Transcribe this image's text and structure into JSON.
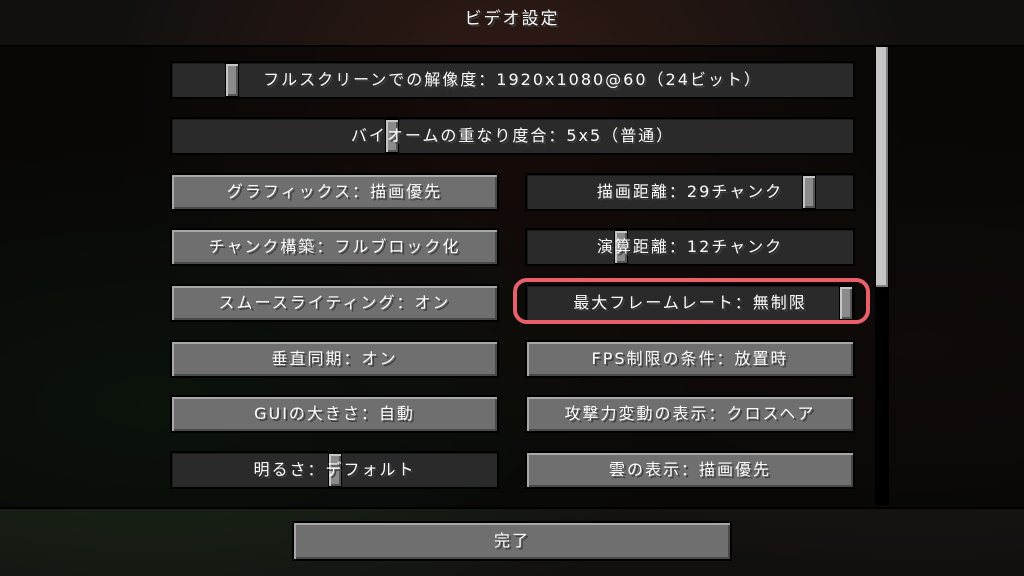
{
  "screen": {
    "title": "ビデオ設定"
  },
  "options": {
    "resolution": {
      "label": "フルスクリーンでの解像度：1920x1080@60（24ビット）",
      "level": 0.08
    },
    "biome_blend": {
      "label": "バイオームの重なり度合：5x5（普通）",
      "level": 0.32
    },
    "graphics": "グラフィックス：描画優先",
    "render_distance": {
      "label": "描画距離：29チャンク",
      "level": 0.88
    },
    "chunk_builder": "チャンク構築：フルブロック化",
    "simulation_distance": {
      "label": "演算距離：12チャンク",
      "level": 0.28
    },
    "smooth_lighting": "スムースライティング：オン",
    "max_framerate": {
      "label": "最大フレームレート：無制限",
      "level": 1.0
    },
    "vsync": "垂直同期：オン",
    "fps_limit_condition": "FPS制限の条件：放置時",
    "gui_scale": "GUIの大きさ：自動",
    "attack_indicator": "攻撃力変動の表示：クロスヘア",
    "brightness": {
      "label": "明るさ：デフォルト",
      "level": 0.5
    },
    "clouds": "雲の表示：描画優先"
  },
  "footer": {
    "done_label": "完了"
  },
  "colors": {
    "highlight": "#e9606b",
    "button_face": "#6f6f6f",
    "slider_face": "#2a2a2a",
    "text": "#ffffff"
  }
}
